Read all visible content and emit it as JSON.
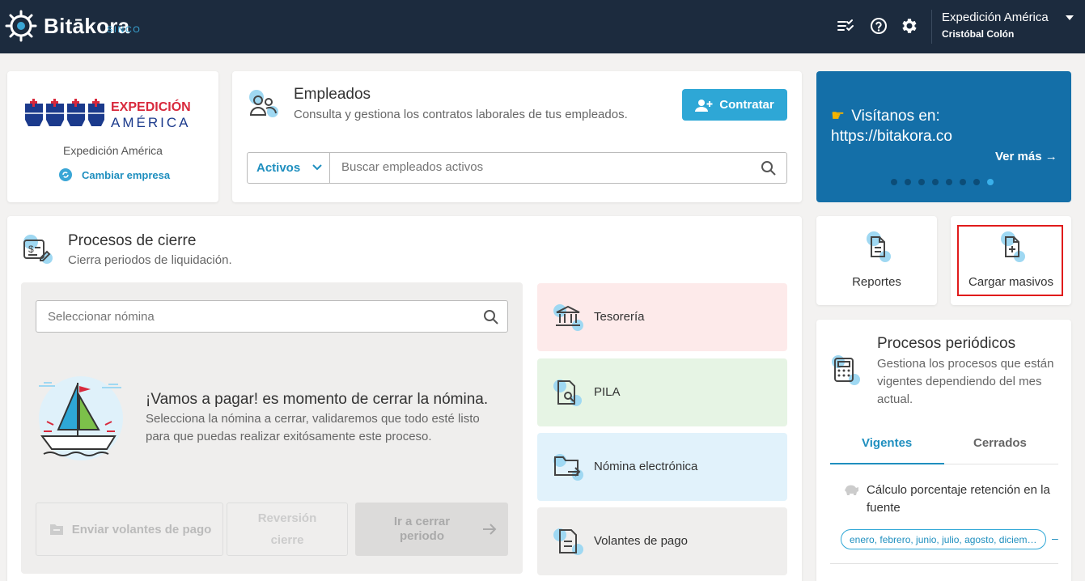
{
  "header": {
    "app_name": "Bitākora",
    "app_sub": "SINCO",
    "company": "Expedición América",
    "user": "Cristóbal Colón",
    "icons": [
      "tasks-icon",
      "help-icon",
      "gear-icon",
      "caret-down-icon"
    ]
  },
  "company_card": {
    "logo_line1": "EXPEDICIÓN",
    "logo_line2": "AMÉRICA",
    "name": "Expedición América",
    "change_label": "Cambiar empresa"
  },
  "empleados": {
    "title": "Empleados",
    "description": "Consulta y gestiona los contratos laborales de tus empleados.",
    "hire_button": "Contratar",
    "filter_value": "Activos",
    "search_placeholder": "Buscar empleados activos"
  },
  "banner": {
    "line1": "Visítanos en:",
    "line2": "https://bitakora.co",
    "more": "Ver más →",
    "slide_count": 8,
    "active_slide": 8
  },
  "quick_actions": {
    "reports": "Reportes",
    "bulk_upload": "Cargar masivos"
  },
  "procesos_cierre": {
    "title": "Procesos de cierre",
    "description": "Cierra periodos de liquidación.",
    "search_placeholder": "Seleccionar nómina",
    "pay_title": "¡Vamos a pagar! es momento de cerrar la nómina.",
    "pay_desc": "Selecciona la nómina a cerrar, validaremos que todo esté listo para que puedas realizar exitósamente este proceso.",
    "btn_send": "Enviar volantes de pago",
    "btn_reverse": "Reversión cierre",
    "btn_close": "Ir a cerrar periodo",
    "items": [
      {
        "label": "Tesorería",
        "bg": "#fdeaea"
      },
      {
        "label": "PILA",
        "bg": "#e6f4e4"
      },
      {
        "label": "Nómina electrónica",
        "bg": "#e1f2fb"
      },
      {
        "label": "Volantes de pago",
        "bg": "#efeeed"
      }
    ]
  },
  "procesos_periodicos": {
    "title": "Procesos periódicos",
    "description": "Gestiona los procesos que están vigentes dependiendo del mes actual.",
    "tab_active": "Vigentes",
    "tab_other": "Cerrados",
    "item_label": "Cálculo porcentaje retención en la fuente",
    "item_months": "enero, febrero, junio, julio, agosto, diciem…",
    "item_more": "–"
  },
  "colors": {
    "topbar": "#1c2b3e",
    "accent": "#2ea7d6",
    "banner": "#146fa8",
    "highlight": "#e01b1b"
  }
}
